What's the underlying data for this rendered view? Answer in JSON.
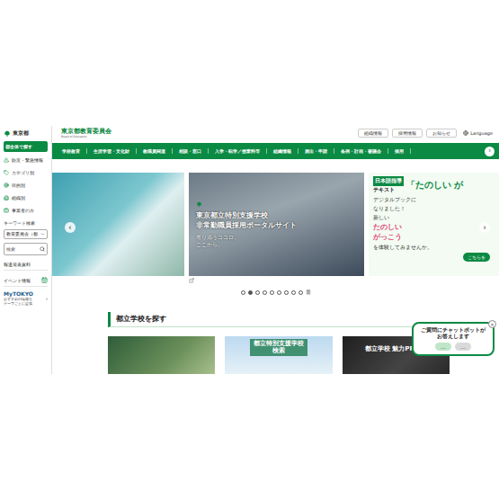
{
  "sidebar": {
    "logo": "東京都",
    "primary_button": "都全体で探す",
    "items": [
      {
        "label": "防災・緊急情報"
      },
      {
        "label": "カテゴリ別"
      },
      {
        "label": "目的別"
      },
      {
        "label": "組織別"
      },
      {
        "label": "事業者の方"
      }
    ],
    "search_label": "キーワード検索",
    "select_value": "教育委員会（都",
    "search_placeholder": "検索",
    "links": [
      {
        "label": "報道発表資料"
      },
      {
        "label": "イベント情報"
      }
    ],
    "mytokyo": {
      "title": "MyTOKYO",
      "lines": [
        "おすすめの情報を",
        "テーマごとに提供"
      ],
      "arrow": "›"
    }
  },
  "header": {
    "title": "東京都教育委員会",
    "subtitle": "Board of Education",
    "links": [
      "組織情報",
      "採用情報",
      "お知らせ"
    ],
    "language": "Language"
  },
  "nav": {
    "items": [
      "学校教育",
      "生涯学習・文化財",
      "教職員関連",
      "相談・窓口",
      "入学・転学／授業料等",
      "組織情報",
      "届出・申請",
      "条例・計画・審議会",
      "採用"
    ],
    "more": "›"
  },
  "carousel": {
    "prev": "‹",
    "next": "›",
    "slides": [
      {
        "kind": "photo"
      },
      {
        "kind": "feature",
        "title": [
          "東京都立特別支援学校",
          "非常勤職員採用ポータルサイト"
        ],
        "tagline": [
          "寄り添うココロ、",
          "ここから。"
        ]
      },
      {
        "kind": "promo",
        "label": "日本語指導",
        "sub": "テキスト",
        "headline": "「たのしい が",
        "lines": [
          "デジタルブックに",
          "なりました！"
        ],
        "new": "新しい",
        "book": [
          "たのしい",
          "がっこう"
        ],
        "invite": "を体験してみませんか。",
        "button": "こちらを"
      }
    ],
    "dots": [
      {
        "selected": false
      },
      {
        "selected": true
      },
      {
        "selected": false
      },
      {
        "selected": false
      },
      {
        "selected": false
      },
      {
        "selected": false
      },
      {
        "selected": false
      },
      {
        "selected": false
      },
      {
        "selected": false
      }
    ]
  },
  "section": {
    "title": "都立学校を探す",
    "cards": [
      {
        "kind": "photo"
      },
      {
        "kind": "label",
        "text": [
          "都立特別支援学校",
          "検索"
        ]
      },
      {
        "kind": "video",
        "text": "都立学校 魅力PR動画"
      }
    ]
  },
  "chatbot": {
    "lines": [
      "ご質問にチャットボットが",
      "お答えします"
    ],
    "bubbles": [
      "…",
      "…"
    ],
    "close": "×"
  }
}
